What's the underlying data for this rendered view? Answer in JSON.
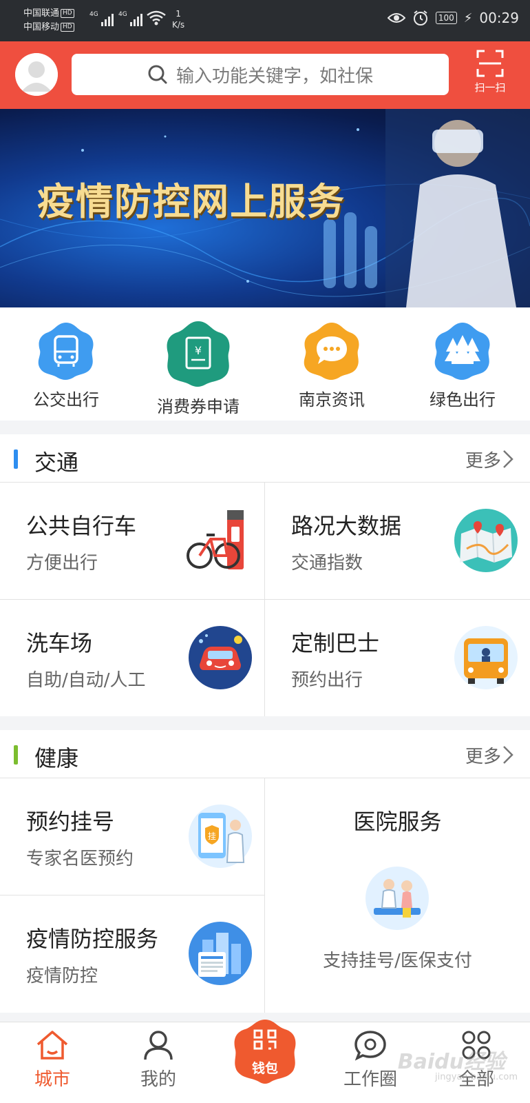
{
  "status_bar": {
    "carrier1": "中国联通",
    "carrier2": "中国移动",
    "hd": "HD",
    "net": "4G",
    "speed_value": "1",
    "speed_unit": "K/s",
    "battery": "100",
    "time": "00:29"
  },
  "header": {
    "search_placeholder": "输入功能关键字，如社保",
    "scan_label": "扫一扫"
  },
  "banner": {
    "title": "疫情防控网上服务"
  },
  "quick_services": [
    {
      "label": "公交出行",
      "color": "#3f9cf0"
    },
    {
      "label": "消费券申请",
      "color": "#1f9b7e"
    },
    {
      "label": "南京资讯",
      "color": "#f6a623"
    },
    {
      "label": "绿色出行",
      "color": "#3f9cf0"
    }
  ],
  "traffic": {
    "title": "交通",
    "more": "更多",
    "accent": "#2e8ef0",
    "cards": [
      {
        "title": "公共自行车",
        "subtitle": "方便出行",
        "icon": "bicycle-icon"
      },
      {
        "title": "路况大数据",
        "subtitle": "交通指数",
        "icon": "map-icon"
      },
      {
        "title": "洗车场",
        "subtitle": "自助/自动/人工",
        "icon": "car-wash-icon"
      },
      {
        "title": "定制巴士",
        "subtitle": "预约出行",
        "icon": "bus-icon"
      }
    ]
  },
  "health": {
    "title": "健康",
    "more": "更多",
    "accent": "#7cbd2f",
    "cards": [
      {
        "title": "预约挂号",
        "subtitle": "专家名医预约",
        "icon": "registration-icon"
      },
      {
        "title": "医院服务",
        "subtitle": "支持挂号/医保支付",
        "icon": "hospital-icon"
      },
      {
        "title": "疫情防控服务",
        "subtitle": "疫情防控",
        "icon": "city-icon"
      }
    ]
  },
  "bottom_nav": {
    "items": [
      {
        "label": "城市",
        "active": true
      },
      {
        "label": "我的"
      },
      {
        "label": "钱包"
      },
      {
        "label": "工作圈"
      },
      {
        "label": "全部"
      }
    ],
    "active_color": "#ef5a2f",
    "watermark": "Baidu经验",
    "watermark_sub": "jingyan.baidu.com"
  }
}
